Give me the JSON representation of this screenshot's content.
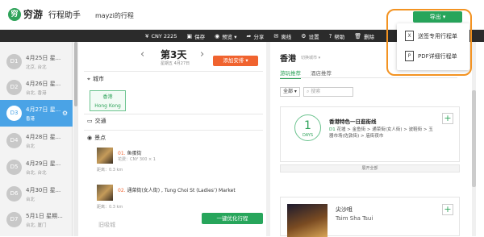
{
  "header": {
    "logo_mark": "穷",
    "brand": "穷游",
    "product": "行程助手",
    "trip_title": "mayzi的行程",
    "export_label": "导出 ▾"
  },
  "toolbar": {
    "items": [
      {
        "icon": "¥",
        "label": "CNY 2225"
      },
      {
        "icon": "▣",
        "label": "保存"
      },
      {
        "icon": "◉",
        "label": "预览 ▾"
      },
      {
        "icon": "➦",
        "label": "分享"
      },
      {
        "icon": "✉",
        "label": "离线"
      },
      {
        "icon": "⚙",
        "label": "设置"
      },
      {
        "icon": "?",
        "label": "帮助"
      },
      {
        "icon": "🗑",
        "label": "删除"
      }
    ]
  },
  "days": [
    {
      "num": "D1",
      "date": "4月25日 星...",
      "cities": "北京, 台北"
    },
    {
      "num": "D2",
      "date": "4月26日 星...",
      "cities": "台北, 香港"
    },
    {
      "num": "D3",
      "date": "4月27日 星...",
      "cities": "香港",
      "active": true
    },
    {
      "num": "D4",
      "date": "4月28日 星...",
      "cities": "台北"
    },
    {
      "num": "D5",
      "date": "4月29日 星...",
      "cities": "台北, 台北"
    },
    {
      "num": "D6",
      "date": "4月30日 星...",
      "cities": "台北"
    },
    {
      "num": "D7",
      "date": "5月1日 星期...",
      "cities": "台北, 厦门"
    }
  ],
  "center": {
    "day_label": "第3天",
    "day_date": "星期五 4月27日",
    "add_label": "添加安排 ▾",
    "city_section": "城市",
    "city_tag_cn": "香港",
    "city_tag_en": "Hong Kong",
    "transport_section": "交通",
    "sights_section": "景点",
    "sights": [
      {
        "n": "01.",
        "name": "鱼蛋街",
        "meta": "花费：CNY 300 × 1",
        "dist": "距离：0.3 km"
      },
      {
        "n": "02.",
        "name": "通菜街(女人街) , Tung Choi St (Ladies’) Market",
        "meta": "",
        "dist": "距离：0.3 km"
      }
    ],
    "next_partial": "旧吸城",
    "optimize_label": "一键优化行程"
  },
  "right": {
    "city": "香港",
    "switch": "切换城市 ▾",
    "tabs": [
      "游玩推荐",
      "酒店推荐"
    ],
    "filter": "全部 ▾",
    "search_placeholder": "搜索",
    "card": {
      "days_num": "1",
      "days_label": "DAYS",
      "title": "香港特色一日逛街线",
      "d_label": "D1",
      "route": "花墟 > 金鱼街 > 通菜街(女人街) > 波鞋街 > 玉器市场(佐敦街) > 庙街夜市"
    },
    "expand_label": "展开全部",
    "spot": {
      "cn": "尖沙咀",
      "en": "Tsim Sha Tsui"
    }
  },
  "dropdown": {
    "items": [
      {
        "icon": "X",
        "label": "送签专用行程单"
      },
      {
        "icon": "P",
        "label": "PDF详细行程单"
      }
    ]
  }
}
